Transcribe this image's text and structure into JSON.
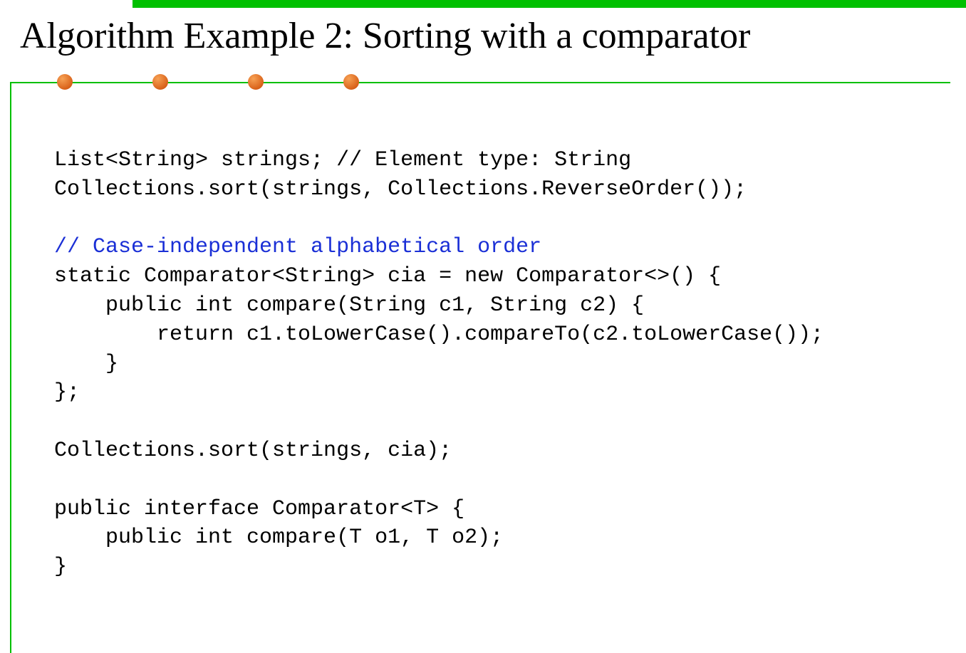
{
  "title": "Algorithm Example 2: Sorting with a comparator",
  "code": {
    "l1": "List<String> strings; // Element type: String",
    "l2": "Collections.sort(strings, Collections.ReverseOrder());",
    "blank1": "",
    "comment1": "// Case-independent alphabetical order",
    "l3": "static Comparator<String> cia = new Comparator<>() {",
    "l4": "    public int compare(String c1, String c2) {",
    "l5": "        return c1.toLowerCase().compareTo(c2.toLowerCase());",
    "l6": "    }",
    "l7": "};",
    "blank2": "",
    "l8": "Collections.sort(strings, cia);",
    "blank3": "",
    "l9": "public interface Comparator<T> {",
    "l10": "    public int compare(T o1, T o2);",
    "l11": "}"
  }
}
